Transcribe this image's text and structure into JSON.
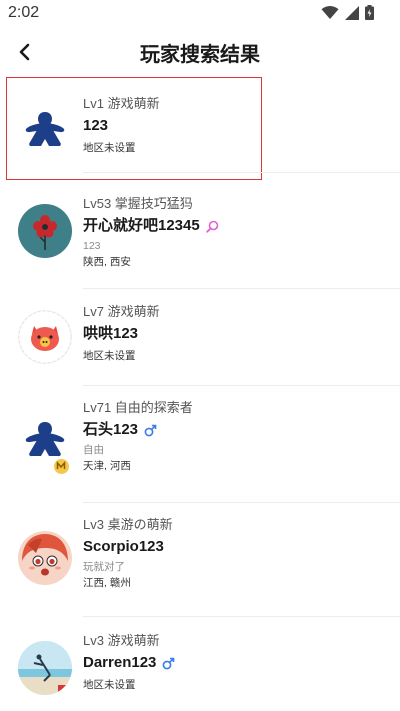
{
  "status": {
    "time": "2:02",
    "icons": [
      "wifi-icon",
      "cellular-signal-icon",
      "battery-icon"
    ]
  },
  "header": {
    "title": "玩家搜索结果",
    "back_icon": "back-arrow-icon"
  },
  "colors": {
    "selection_border": "#d8373a",
    "male_icon": "#3b7bea",
    "search_icon": "#e35fd0",
    "meeple_blue": "#1d3f8a"
  },
  "results": [
    {
      "level": "Lv1 游戏萌新",
      "name": "123",
      "signature": "",
      "location": "地区未设置",
      "badge": "",
      "avatar": "meeple-avatar",
      "selected": true
    },
    {
      "level": "Lv53 掌握技巧猛犸",
      "name": "开心就好吧12345",
      "signature": "123",
      "location": "陕西, 西安",
      "badge": "search-icon",
      "avatar": "red-flower-avatar"
    },
    {
      "level": "Lv7 游戏萌新",
      "name": "哄哄123",
      "signature": "",
      "location": "地区未设置",
      "badge": "",
      "avatar": "pig-avatar"
    },
    {
      "level": "Lv71 自由的探索者",
      "name": "石头123",
      "signature": "自由",
      "location": "天津, 河西",
      "badge": "male-icon",
      "avatar": "meeple-avatar-with-m-badge"
    },
    {
      "level": "Lv3 桌游の萌新",
      "name": "Scorpio123",
      "signature": "玩就对了",
      "location": "江西, 赣州",
      "badge": "",
      "avatar": "anime-girl-avatar"
    },
    {
      "level": "Lv3 游戏萌新",
      "name": "Darren123",
      "signature": "",
      "location": "地区未设置",
      "badge": "male-icon",
      "avatar": "beach-photo-avatar"
    }
  ]
}
